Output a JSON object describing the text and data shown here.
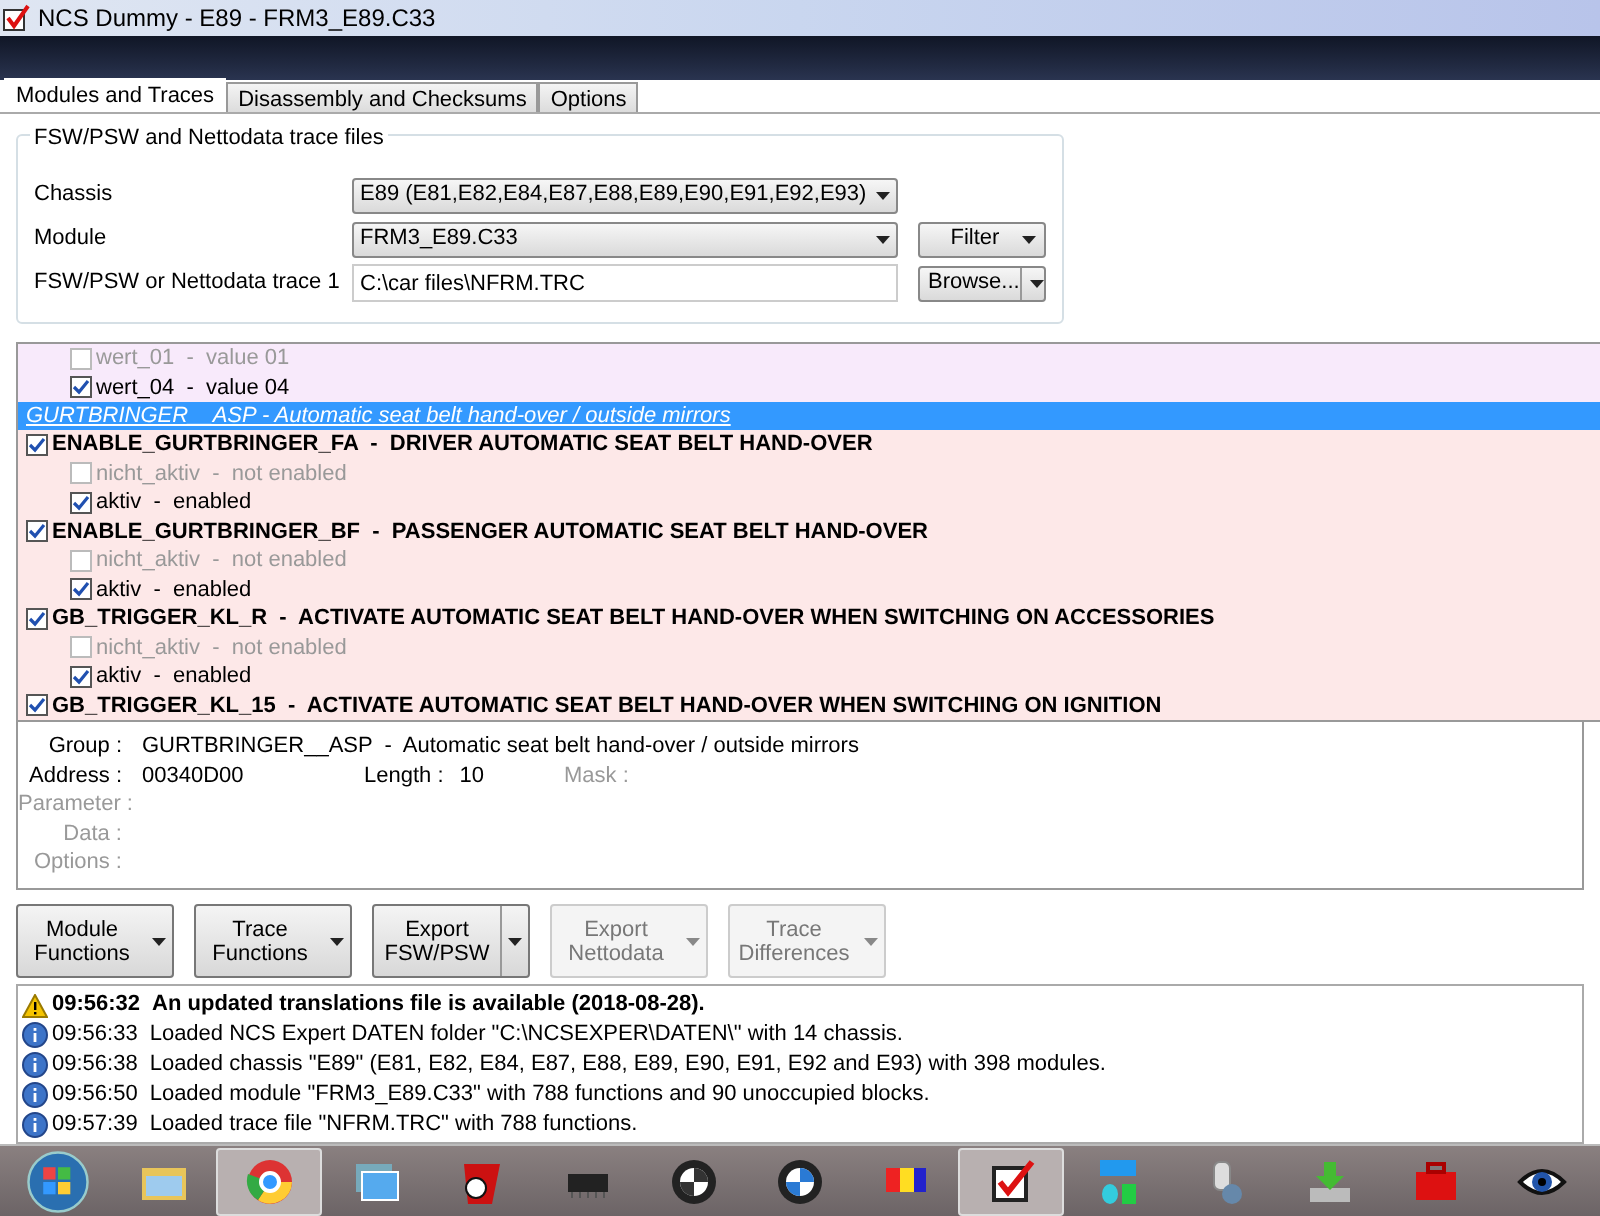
{
  "window": {
    "title": "NCS Dummy - E89 - FRM3_E89.C33"
  },
  "tabs": [
    {
      "label": "Modules and Traces",
      "selected": true
    },
    {
      "label": "Disassembly and Checksums",
      "selected": false
    },
    {
      "label": "Options",
      "selected": false
    }
  ],
  "file_group": {
    "legend": "FSW/PSW and Nettodata trace files",
    "rows": [
      {
        "kind": "combo",
        "label": "Chassis",
        "value": "E89  (E81,E82,E84,E87,E88,E89,E90,E91,E92,E93)"
      },
      {
        "kind": "combo",
        "label": "Module",
        "value": "FRM3_E89.C33",
        "button": "Filter"
      },
      {
        "kind": "text",
        "label": "FSW/PSW or Nettodata trace 1",
        "value": "C:\\car files\\NFRM.TRC",
        "button": "Browse..."
      }
    ]
  },
  "tree": [
    {
      "kind": "options",
      "items": [
        {
          "label": "wert_01  -  value 01",
          "checked": false
        },
        {
          "label": "wert_04  -  value 04",
          "checked": true
        }
      ]
    },
    {
      "kind": "group",
      "label": "GURTBRINGER__ASP  -  Automatic seat belt hand-over / outside mirrors",
      "selected": true,
      "items": [
        {
          "label": "ENABLE_GURTBRINGER_FA  -  DRIVER AUTOMATIC SEAT BELT HAND-OVER",
          "checked": true,
          "children": [
            {
              "label": "nicht_aktiv  -  not enabled",
              "checked": false
            },
            {
              "label": "aktiv  -  enabled",
              "checked": true
            }
          ]
        },
        {
          "label": "ENABLE_GURTBRINGER_BF  -  PASSENGER AUTOMATIC SEAT BELT HAND-OVER",
          "checked": true,
          "children": [
            {
              "label": "nicht_aktiv  -  not enabled",
              "checked": false
            },
            {
              "label": "aktiv  -  enabled",
              "checked": true
            }
          ]
        },
        {
          "label": "GB_TRIGGER_KL_R  -  ACTIVATE AUTOMATIC SEAT BELT HAND-OVER WHEN SWITCHING ON ACCESSORIES",
          "checked": true,
          "children": [
            {
              "label": "nicht_aktiv  -  not enabled",
              "checked": false
            },
            {
              "label": "aktiv  -  enabled",
              "checked": true
            }
          ]
        },
        {
          "label": "GB_TRIGGER_KL_15  -  ACTIVATE AUTOMATIC SEAT BELT HAND-OVER WHEN SWITCHING ON IGNITION",
          "checked": true
        }
      ]
    }
  ],
  "details": [
    {
      "label": "Group :",
      "value": "GURTBRINGER__ASP  -  Automatic seat belt hand-over / outside mirrors",
      "disabled": false
    },
    {
      "label": "Address :",
      "value": "00340D00",
      "disabled": false,
      "extra": [
        {
          "label": "Length :",
          "value": "10",
          "disabled": false
        },
        {
          "label": "Mask :",
          "disabled": true
        }
      ]
    },
    {
      "label": "Parameter :",
      "disabled": true
    },
    {
      "label": "Data :",
      "disabled": true
    },
    {
      "label": "Options :",
      "disabled": true
    }
  ],
  "actions": [
    {
      "lines": [
        "Module",
        "Functions"
      ],
      "kind": "menu",
      "disabled": false
    },
    {
      "lines": [
        "Trace",
        "Functions"
      ],
      "kind": "menu",
      "disabled": false
    },
    {
      "lines": [
        "Export",
        "FSW/PSW"
      ],
      "kind": "split",
      "disabled": false
    },
    {
      "lines": [
        "Export",
        "Nettodata"
      ],
      "kind": "menu",
      "disabled": true
    },
    {
      "lines": [
        "Trace",
        "Differences"
      ],
      "kind": "menu",
      "disabled": true
    }
  ],
  "log": [
    {
      "kind": "warning",
      "time": "09:56:32",
      "message": "An updated translations file is available (2018-08-28)."
    },
    {
      "kind": "info",
      "time": "09:56:33",
      "message": "Loaded NCS Expert DATEN folder \"C:\\NCSEXPER\\DATEN\\\" with 14 chassis."
    },
    {
      "kind": "info",
      "time": "09:56:38",
      "message": "Loaded chassis \"E89\" (E81, E82, E84, E87, E88, E89, E90, E91, E92 and E93) with 398 modules."
    },
    {
      "kind": "info",
      "time": "09:56:50",
      "message": "Loaded module \"FRM3_E89.C33\" with 788 functions and 90 unoccupied blocks."
    },
    {
      "kind": "info",
      "time": "09:57:39",
      "message": "Loaded trace file \"NFRM.TRC\" with 788 functions."
    }
  ],
  "taskbar": [
    {
      "kind": "start",
      "selected": false
    },
    {
      "kind": "folder",
      "selected": false
    },
    {
      "kind": "browser",
      "selected": true
    },
    {
      "kind": "cards",
      "selected": false
    },
    {
      "kind": "red-badge",
      "selected": false
    },
    {
      "kind": "chip",
      "selected": false
    },
    {
      "kind": "roundel-dark",
      "selected": false
    },
    {
      "kind": "roundel",
      "selected": false
    },
    {
      "kind": "blocks",
      "selected": false
    },
    {
      "kind": "checkmark",
      "selected": true
    },
    {
      "kind": "kfp",
      "selected": false
    },
    {
      "kind": "bottles",
      "selected": false
    },
    {
      "kind": "download",
      "selected": false
    },
    {
      "kind": "toolbox",
      "selected": false
    },
    {
      "kind": "eye",
      "selected": false
    }
  ]
}
